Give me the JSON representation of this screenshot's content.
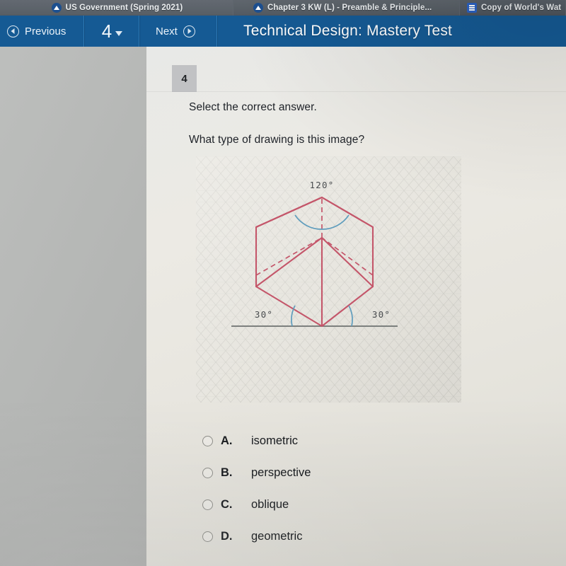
{
  "browser": {
    "tabs": [
      {
        "title": "US Government (Spring 2021)",
        "icon": "edgenuity-favicon"
      },
      {
        "title": "Chapter 3 KW (L) - Preamble & Principle...",
        "icon": "edgenuity-favicon"
      },
      {
        "title": "Copy of World's Wat",
        "icon": "google-docs-favicon"
      }
    ]
  },
  "toolbar": {
    "previous_label": "Previous",
    "question_number": "4",
    "next_label": "Next",
    "title": "Technical Design: Mastery Test",
    "accent_color": "#155a94"
  },
  "question": {
    "number": "4",
    "instruction": "Select the correct answer.",
    "prompt": "What type of drawing is this image?"
  },
  "figure": {
    "description": "isometric cube on isometric grid paper",
    "line_color": "#c4566a",
    "arc_color": "#5f9dbd",
    "baseline_color": "#6e7270",
    "labels": {
      "top_angle": "120°",
      "left_angle": "30°",
      "right_angle": "30°"
    }
  },
  "choices": [
    {
      "letter": "A.",
      "text": "isometric",
      "selected": false
    },
    {
      "letter": "B.",
      "text": "perspective",
      "selected": false
    },
    {
      "letter": "C.",
      "text": "oblique",
      "selected": false
    },
    {
      "letter": "D.",
      "text": "geometric",
      "selected": false
    }
  ]
}
